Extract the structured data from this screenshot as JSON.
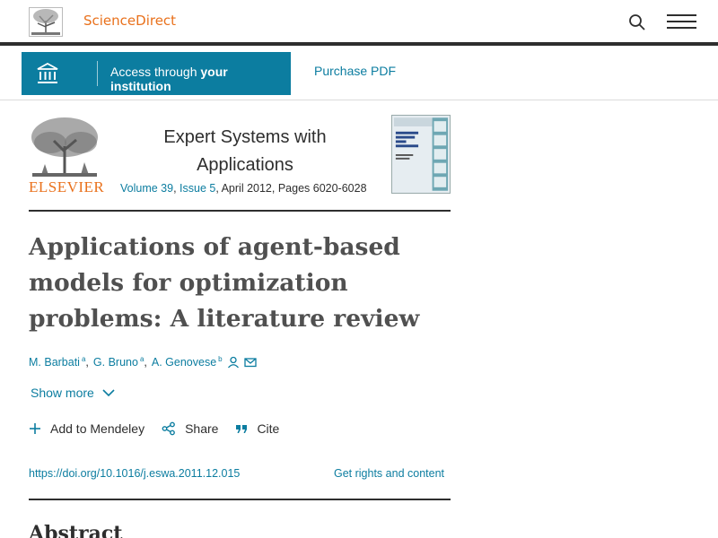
{
  "header": {
    "brand": "ScienceDirect",
    "brand_color": "#e9711c",
    "icons": [
      "elsevier-tree-logo",
      "search-icon",
      "hamburger-menu-icon"
    ]
  },
  "access": {
    "button_prefix": "Access through ",
    "button_bold": "your institution",
    "purchase_label": "Purchase PDF",
    "accent_color": "#0c7da0"
  },
  "journal": {
    "publisher": "ELSEVIER",
    "title": "Expert Systems with Applications",
    "volume": "Volume 39",
    "issue": "Issue 5",
    "date_pages": ", April 2012, Pages 6020-6028",
    "sep": ", "
  },
  "article": {
    "title": "Applications of agent-based models for optimization problems: A literature review",
    "authors": [
      {
        "name": "M. Barbati",
        "aff": "a"
      },
      {
        "name": "G. Bruno",
        "aff": "a"
      },
      {
        "name": "A. Genovese",
        "aff": "b"
      }
    ],
    "show_more": "Show more",
    "actions": {
      "mendeley": "Add to Mendeley",
      "share": "Share",
      "cite": "Cite"
    },
    "doi": "https://doi.org/10.1016/j.eswa.2011.12.015",
    "rights": "Get rights and content",
    "abstract_heading": "Abstract"
  }
}
